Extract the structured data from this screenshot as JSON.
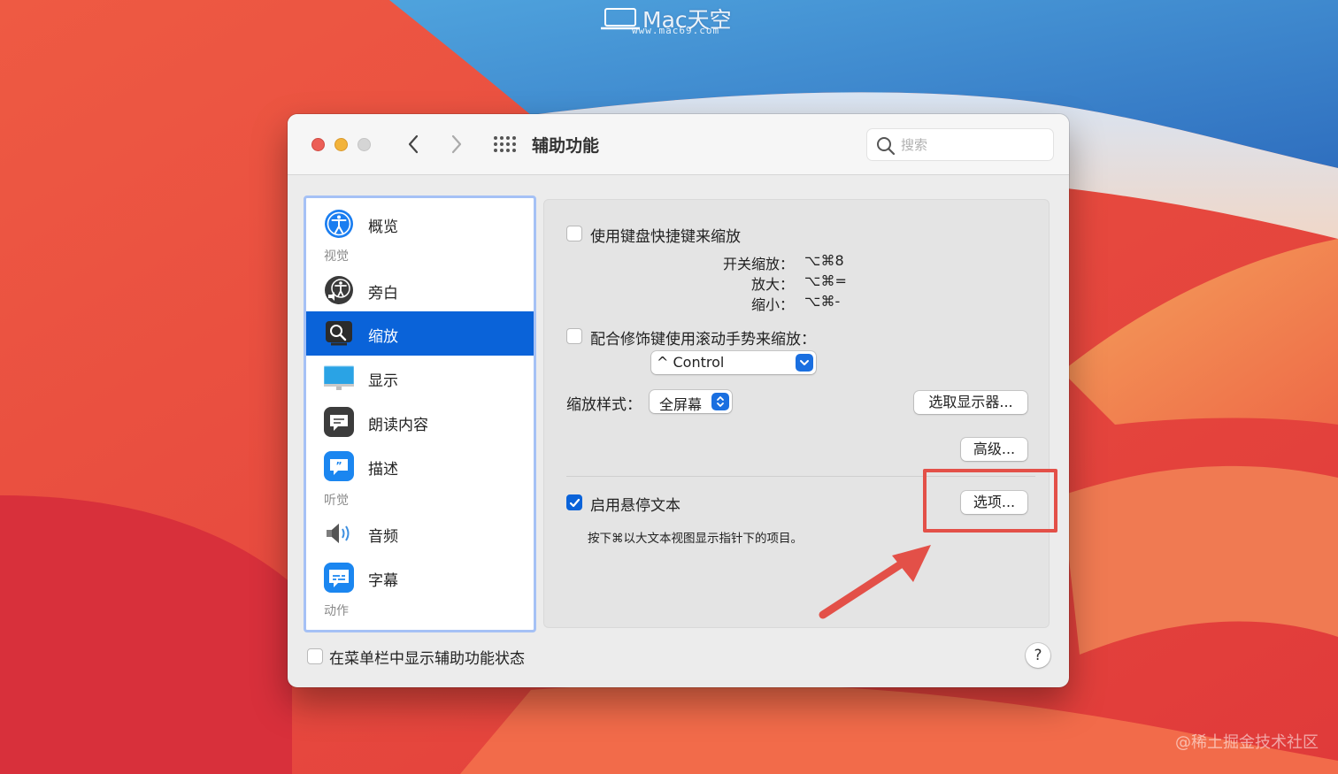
{
  "watermarks": {
    "top_brand": "Mac天空",
    "top_url": "www.mac69.com",
    "bottom": "@稀土掘金技术社区"
  },
  "window": {
    "title": "辅助功能",
    "search_placeholder": "搜索",
    "nav": {
      "back_icon": "chevron-left-icon",
      "forward_icon": "chevron-right-icon",
      "grid_icon": "grid-icon"
    }
  },
  "sidebar": {
    "items": [
      {
        "label": "概览",
        "icon": "accessibility-icon"
      },
      {
        "label": "旁白",
        "icon": "voiceover-icon"
      },
      {
        "label": "缩放",
        "icon": "zoom-icon",
        "selected": true
      },
      {
        "label": "显示",
        "icon": "display-icon"
      },
      {
        "label": "朗读内容",
        "icon": "speech-icon"
      },
      {
        "label": "描述",
        "icon": "description-icon"
      },
      {
        "label": "音频",
        "icon": "speaker-icon"
      },
      {
        "label": "字幕",
        "icon": "captions-icon"
      }
    ],
    "sections": {
      "vision": "视觉",
      "hearing": "听觉",
      "motor": "动作"
    }
  },
  "zoom": {
    "keyboard_shortcuts": {
      "label": "使用键盘快捷键来缩放",
      "checked": false,
      "rows": [
        {
          "key": "开关缩放：",
          "value": "⌥⌘8"
        },
        {
          "key": "放大：",
          "value": "⌥⌘="
        },
        {
          "key": "缩小：",
          "value": "⌥⌘-"
        }
      ]
    },
    "scroll_gesture": {
      "label": "配合修饰键使用滚动手势来缩放：",
      "checked": false,
      "modifier": "^ Control"
    },
    "zoom_style": {
      "label": "缩放样式：",
      "value": "全屏幕"
    },
    "choose_display_button": "选取显示器...",
    "advanced_button": "高级...",
    "hover_text": {
      "label": "启用悬停文本",
      "checked": true,
      "options_button": "选项...",
      "hint": "按下⌘以大文本视图显示指针下的项目。"
    }
  },
  "footer": {
    "show_in_menubar_label": "在菜单栏中显示辅助功能状态",
    "show_in_menubar_checked": false,
    "help_label": "?"
  },
  "colors": {
    "accent": "#0a63d9",
    "annotation": "#e35048"
  }
}
